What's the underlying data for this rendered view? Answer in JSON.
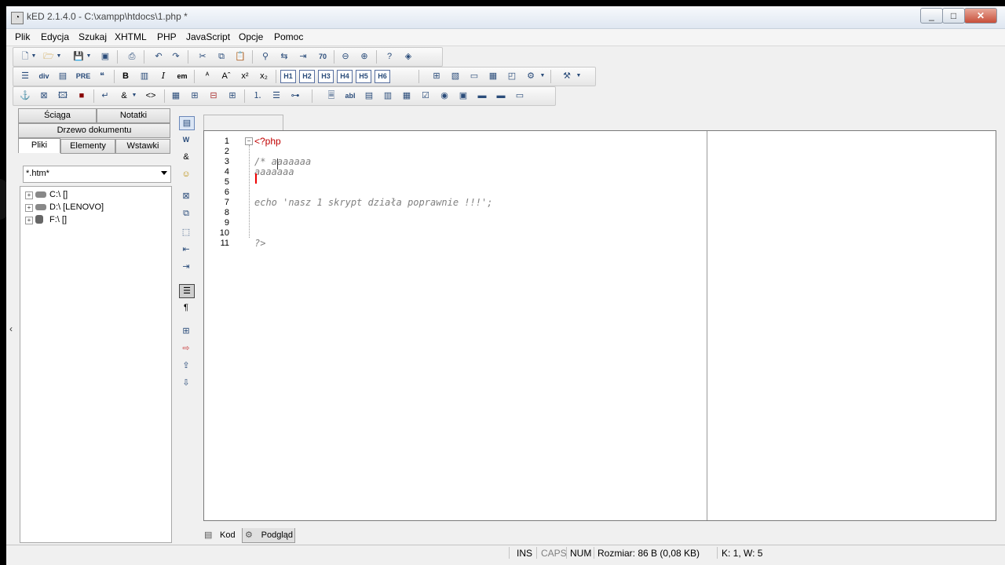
{
  "window": {
    "title": "kED 2.1.4.0 - C:\\xampp\\htdocs\\1.php *",
    "minimize": "_",
    "maximize": "□",
    "close": "✕"
  },
  "menu": [
    "Plik",
    "Edycja",
    "Szukaj",
    "XHTML",
    "PHP",
    "JavaScript",
    "Opcje",
    "Pomoc"
  ],
  "toolbar2": {
    "pre": "PRE",
    "bold": "B",
    "italic": "I",
    "em": "em",
    "headings": [
      "H1",
      "H2",
      "H3",
      "H4",
      "H5",
      "H6"
    ],
    "superscript": "x²",
    "subscript": "x₂"
  },
  "toolbar1": {
    "goto_line": "70"
  },
  "toolbar3": {
    "amp": "&",
    "code": "<>"
  },
  "left_panel": {
    "tabs_top": [
      "Ściąga",
      "Notatki"
    ],
    "tab_middle": "Drzewo dokumentu",
    "tabs_bottom": [
      "Pliki",
      "Elementy",
      "Wstawki"
    ],
    "filter": "*.htm*",
    "drives": [
      "C:\\ []",
      "D:\\ [LENOVO]",
      "F:\\ []"
    ]
  },
  "editor": {
    "lines": [
      "1",
      "2",
      "3",
      "4",
      "5",
      "6",
      "7",
      "8",
      "9",
      "10",
      "11"
    ],
    "code": {
      "l1": "<?php",
      "l3": "/* aaaaaaa",
      "l4": "aaaaaaa",
      "l7": "echo 'nasz 1 skrypt działa poprawnie !!!';",
      "l11": "?>"
    }
  },
  "bottom_tabs": [
    "Kod",
    "Podgląd"
  ],
  "status": {
    "ins": "INS",
    "caps": "CAPS",
    "num": "NUM",
    "size": "Rozmiar: 86 B (0,08 KB)",
    "position": "K: 1, W: 5"
  },
  "colors": {
    "php_tag": "#c00000",
    "comment": "#808080",
    "cursor": "#e00000"
  }
}
